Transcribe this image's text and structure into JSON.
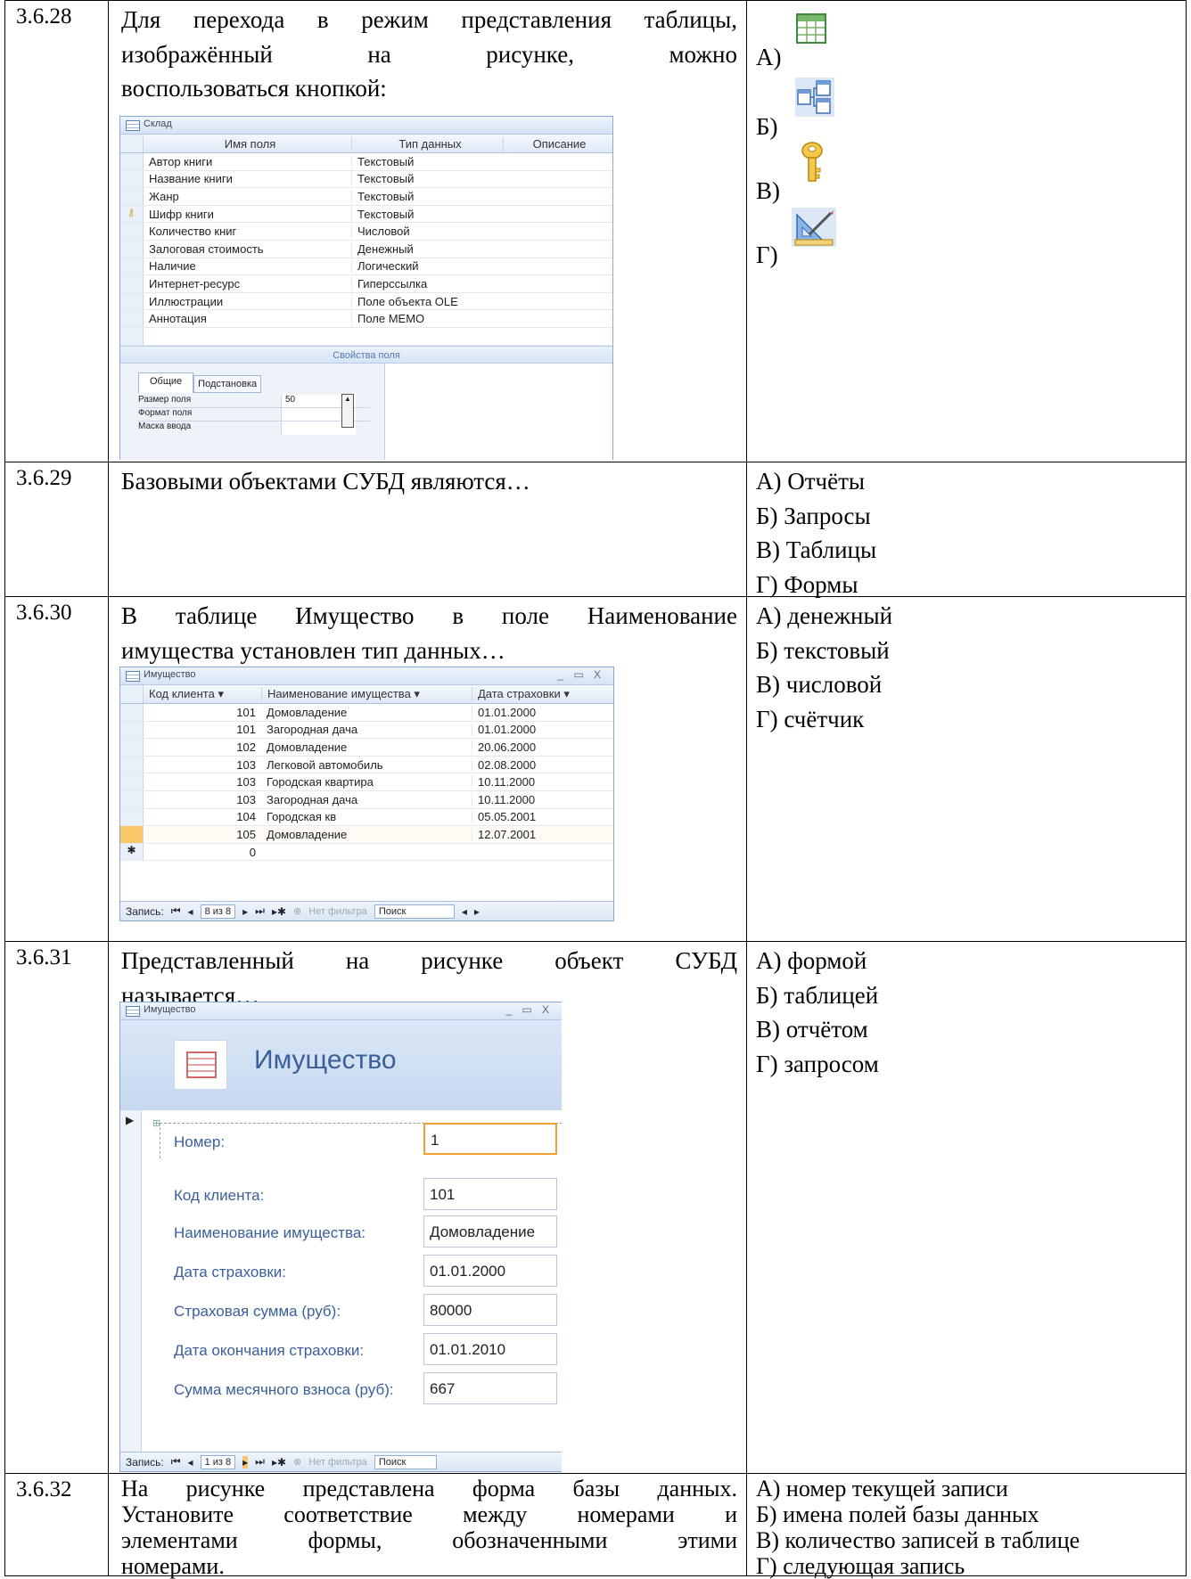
{
  "rows": [
    {
      "num": "3.6.28",
      "q_lines": [
        "Для перехода в режим представления таблицы,",
        "изображённый на рисунке, можно",
        "воспользоваться кнопкой:"
      ],
      "answers": [
        "А)",
        "Б)",
        "В)",
        "Г)"
      ],
      "icons": [
        "table-datasheet-icon",
        "relationships-icon",
        "key-icon",
        "design-view-icon"
      ],
      "window": {
        "title": "Склад",
        "columns": [
          "Имя поля",
          "Тип данных",
          "Описание"
        ],
        "rows": [
          [
            "Автор книги",
            "Текстовый"
          ],
          [
            "Название книги",
            "Текстовый"
          ],
          [
            "Жанр",
            "Текстовый"
          ],
          [
            "Шифр книги",
            "Текстовый"
          ],
          [
            "Количество книг",
            "Числовой"
          ],
          [
            "Залоговая стоимость",
            "Денежный"
          ],
          [
            "Наличие",
            "Логический"
          ],
          [
            "Интернет-ресурс",
            "Гиперссылка"
          ],
          [
            "Иллюстрации",
            "Поле объекта OLE"
          ],
          [
            "Аннотация",
            "Поле МЕМО"
          ]
        ],
        "props_label": "Свойства поля",
        "tabs": [
          "Общие",
          "Подстановка"
        ],
        "props": [
          {
            "name": "Размер поля",
            "value": "50"
          },
          {
            "name": "Формат поля",
            "value": ""
          },
          {
            "name": "Маска ввода",
            "value": ""
          }
        ]
      }
    },
    {
      "num": "3.6.29",
      "q": "Базовыми объектами СУБД являются…",
      "answers": [
        "А) Отчёты",
        "Б) Запросы",
        "В) Таблицы",
        "Г) Формы"
      ]
    },
    {
      "num": "3.6.30",
      "q_lines": [
        "В таблице Имущество в поле Наименование",
        "имущества установлен тип данных…"
      ],
      "answers": [
        "А) денежный",
        "Б) текстовый",
        "В) числовой",
        "Г) счётчик"
      ],
      "window": {
        "title": "Имущество",
        "controls": "_ ▭ X",
        "columns": [
          "Код клиента ▾",
          "Наименование имущества ▾",
          "Дата страховки ▾"
        ],
        "rows": [
          [
            "101",
            "Домовладение",
            "01.01.2000"
          ],
          [
            "101",
            "Загородная дача",
            "01.01.2000"
          ],
          [
            "102",
            "Домовладение",
            "20.06.2000"
          ],
          [
            "103",
            "Легковой автомобиль",
            "02.08.2000"
          ],
          [
            "103",
            "Городская квартира",
            "10.11.2000"
          ],
          [
            "103",
            "Загородная дача",
            "10.11.2000"
          ],
          [
            "104",
            "Городская кв",
            "05.05.2001"
          ],
          [
            "105",
            "Домовладение",
            "12.07.2001"
          ]
        ],
        "new_row_marker": "✱",
        "new_row_value": "0",
        "nav": {
          "label": "Запись:",
          "pos": "8 из 8",
          "filter": "Нет фильтра",
          "search": "Поиск"
        }
      }
    },
    {
      "num": "3.6.31",
      "q_lines": [
        "Представленный на рисунке объект СУБД",
        "называется…"
      ],
      "answers": [
        "А) формой",
        "Б) таблицей",
        "В) отчётом",
        "Г) запросом"
      ],
      "window": {
        "title": "Имущество",
        "controls": "_ ▭ X",
        "header": "Имущество",
        "fields": [
          {
            "label": "Номер:",
            "value": "1"
          },
          {
            "label": "Код клиента:",
            "value": "101"
          },
          {
            "label": "Наименование имущества:",
            "value": "Домовладение"
          },
          {
            "label": "Дата страховки:",
            "value": "01.01.2000"
          },
          {
            "label": "Страховая сумма (руб):",
            "value": "80000"
          },
          {
            "label": "Дата окончания страховки:",
            "value": "01.01.2010"
          },
          {
            "label": "Сумма месячного взноса (руб):",
            "value": "667"
          }
        ],
        "nav": {
          "label": "Запись:",
          "pos": "1 из 8",
          "filter": "Нет фильтра",
          "search": "Поиск"
        }
      }
    },
    {
      "num": "3.6.32",
      "q_lines": [
        "На рисунке представлена форма базы данных.",
        "Установите соответствие между номерами и",
        "элементами формы, обозначенными этими",
        "номерами."
      ],
      "answers": [
        "А) номер текущей записи",
        "Б) имена полей базы данных",
        "В) количество записей в таблице",
        "Г) следующая запись"
      ]
    }
  ]
}
